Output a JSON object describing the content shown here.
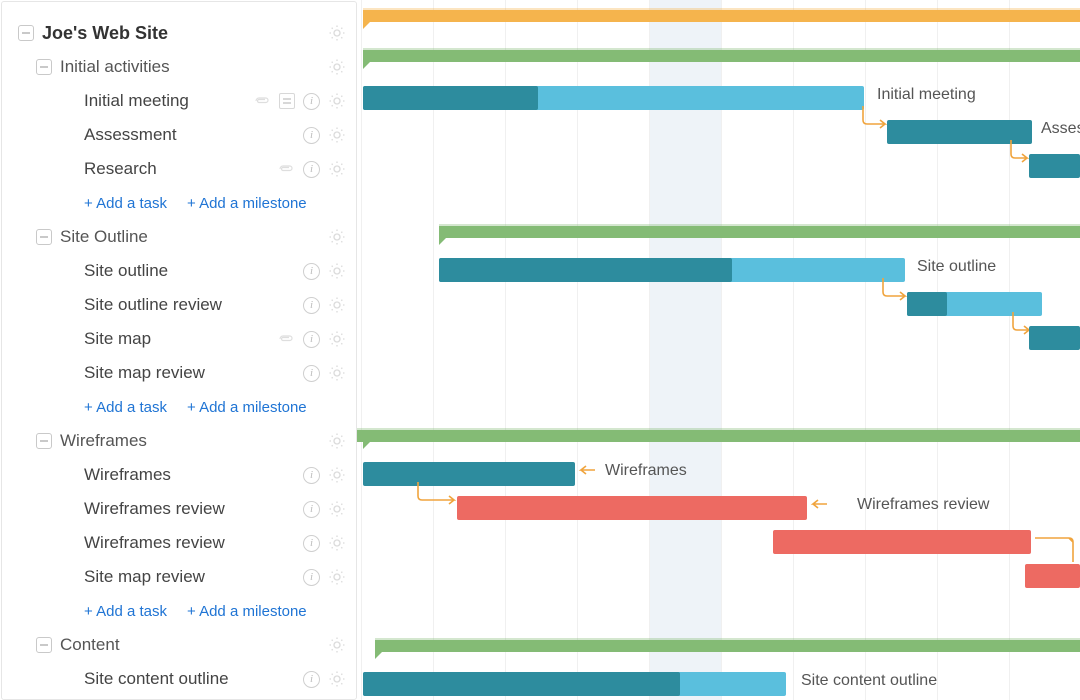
{
  "project": {
    "title": "Joe's Web Site"
  },
  "add": {
    "task": "+ Add a task",
    "milestone": "+ Add a milestone"
  },
  "groups": [
    {
      "name": "Initial activities",
      "tasks": [
        {
          "name": "Initial meeting",
          "hasClip": true,
          "hasNote": true
        },
        {
          "name": "Assessment"
        },
        {
          "name": "Research",
          "hasClip": true
        }
      ]
    },
    {
      "name": "Site Outline",
      "tasks": [
        {
          "name": "Site outline"
        },
        {
          "name": "Site outline review"
        },
        {
          "name": "Site map",
          "hasClip": true
        },
        {
          "name": "Site map review"
        }
      ]
    },
    {
      "name": "Wireframes",
      "tasks": [
        {
          "name": "Wireframes"
        },
        {
          "name": "Wireframes review"
        },
        {
          "name": "Wireframes review"
        },
        {
          "name": "Site map review"
        }
      ]
    },
    {
      "name": "Content",
      "tasks": [
        {
          "name": "Site content outline"
        }
      ]
    }
  ],
  "barlabels": {
    "initial_meeting": "Initial meeting",
    "assessment": "Assessm",
    "site_outline": "Site outline",
    "wireframes": "Wireframes",
    "wireframes_review": "Wireframes review",
    "site_content_outline": "Site content outline"
  },
  "chart_data": {
    "type": "gantt",
    "unit": "days",
    "today_index": 5,
    "summaries": [
      {
        "name": "Joe's Web Site",
        "color": "orange",
        "start": 0,
        "end": 14,
        "extends_right": true
      },
      {
        "name": "Initial activities",
        "color": "green",
        "start": 0,
        "end": 14,
        "extends_right": true
      },
      {
        "name": "Site Outline",
        "color": "green",
        "start": 1,
        "end": 14,
        "extends_right": true
      },
      {
        "name": "Wireframes",
        "color": "green",
        "start": 0,
        "end": 14,
        "extends_right": true
      },
      {
        "name": "Content",
        "color": "green",
        "start": 0,
        "end": 14,
        "extends_right": true
      }
    ],
    "tasks": [
      {
        "group": "Initial activities",
        "name": "Initial meeting",
        "start": 0,
        "end": 8,
        "progress": 0.35,
        "color": "teal"
      },
      {
        "group": "Initial activities",
        "name": "Assessment",
        "start": 8,
        "end": 10.2,
        "progress": 0,
        "color": "teal"
      },
      {
        "group": "Initial activities",
        "name": "Research",
        "start": 10,
        "end": 14,
        "progress": 0,
        "color": "teal",
        "extends_right": true
      },
      {
        "group": "Site Outline",
        "name": "Site outline",
        "start": 1,
        "end": 8.5,
        "progress": 0.66,
        "color": "teal"
      },
      {
        "group": "Site Outline",
        "name": "Site outline review",
        "start": 8.5,
        "end": 10.5,
        "progress": 0.35,
        "color": "teal"
      },
      {
        "group": "Site Outline",
        "name": "Site map",
        "start": 10.3,
        "end": 14,
        "progress": 0,
        "color": "teal",
        "extends_right": true
      },
      {
        "group": "Wireframes",
        "name": "Wireframes",
        "start": 0,
        "end": 3.2,
        "progress": 1.0,
        "color": "teal"
      },
      {
        "group": "Wireframes",
        "name": "Wireframes review",
        "start": 1.4,
        "end": 6.9,
        "progress": 0,
        "color": "red"
      },
      {
        "group": "Wireframes",
        "name": "Wireframes review",
        "start": 6.4,
        "end": 10.3,
        "progress": 0,
        "color": "red"
      },
      {
        "group": "Wireframes",
        "name": "Site map review",
        "start": 10.3,
        "end": 14,
        "progress": 0,
        "color": "red",
        "extends_right": true
      },
      {
        "group": "Content",
        "name": "Site content outline",
        "start": 0,
        "end": 6.5,
        "progress": 0.75,
        "color": "teal"
      }
    ],
    "dependencies": [
      [
        "Initial meeting",
        "Assessment"
      ],
      [
        "Assessment",
        "Research"
      ],
      [
        "Site outline",
        "Site outline review"
      ],
      [
        "Site outline review",
        "Site map"
      ],
      [
        "Wireframes",
        "Wireframes review"
      ],
      [
        "Wireframes review",
        "Wireframes review"
      ],
      [
        "Wireframes review",
        "Site map review"
      ]
    ]
  }
}
